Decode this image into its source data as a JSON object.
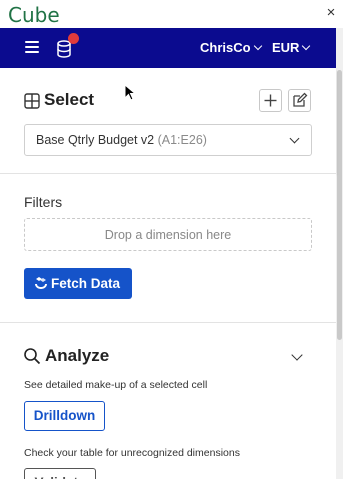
{
  "app": {
    "title": "Cube",
    "close_glyph": "×"
  },
  "navbar": {
    "company": "ChrisCo",
    "currency": "EUR",
    "icons": [
      "menu-icon",
      "database-icon",
      "chevron-down-icon"
    ],
    "colors": {
      "background": "#0b0b8f",
      "notification": "#e03b3b"
    }
  },
  "select": {
    "title": "Select",
    "dropdown_value": "Base Qtrly Budget v2",
    "dropdown_range": "(A1:E26)",
    "icons": [
      "grid-icon",
      "plus-icon",
      "edit-icon"
    ]
  },
  "filters": {
    "label": "Filters",
    "drop_placeholder": "Drop a dimension here",
    "fetch_button": "Fetch Data",
    "colors": {
      "accent": "#1553c9"
    }
  },
  "analyze": {
    "title": "Analyze",
    "drilldown_description": "See detailed make-up of a selected cell",
    "drilldown_button": "Drilldown",
    "validate_description": "Check your table for unrecognized dimensions",
    "validate_button": "Validate",
    "icons": [
      "search-icon",
      "chevron-down-icon"
    ]
  }
}
